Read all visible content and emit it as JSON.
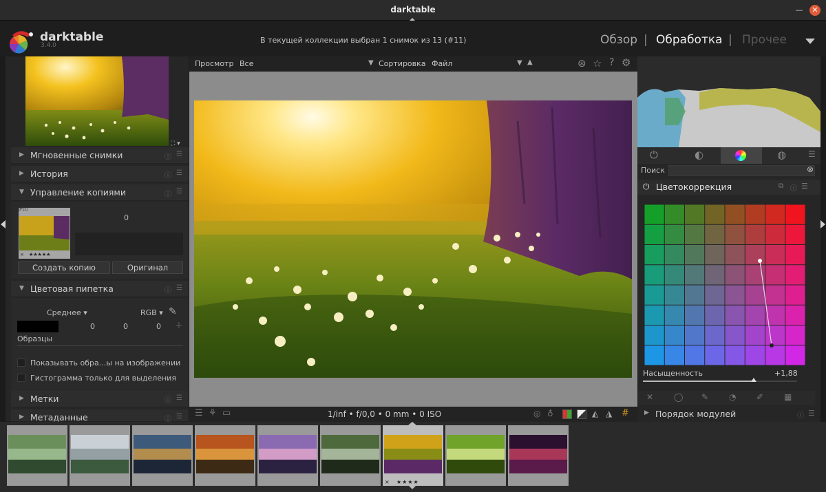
{
  "window": {
    "title": "darktable"
  },
  "header": {
    "app_name": "darktable",
    "version": "3.4.0",
    "collection_info": "В текущей коллекции выбран 1 снимок из 13 (#11)",
    "views": {
      "overview": "Обзор",
      "process": "Обработка",
      "other": "Прочее",
      "separator": "|"
    }
  },
  "left_panel": {
    "modules": {
      "snapshots": "Мгновенные снимки",
      "history": "История",
      "duplicates": "Управление копиями",
      "color_picker": "Цветовая пипетка",
      "tags": "Метки",
      "metadata": "Метаданные"
    },
    "duplicate_manager": {
      "thumb_badge": "JPEG",
      "count": "0",
      "stars": "★★★★★",
      "reject": "×",
      "create_copy": "Создать копию",
      "original": "Оригинал"
    },
    "color_picker": {
      "mode": "Среднее",
      "colorspace": "RGB",
      "values": [
        "0",
        "0",
        "0"
      ],
      "add": "+",
      "samples_label": "Образцы",
      "show_samples": "Показывать обра...ы на изображении",
      "histogram_only": "Гистограмма только для выделения"
    }
  },
  "center": {
    "toolbar": {
      "view_label": "Просмотр",
      "view_value": "Все",
      "sort_label": "Сортировка",
      "sort_value": "Файл"
    },
    "status": "1/inf • f/0,0 • 0 mm • 0 ISO"
  },
  "right_panel": {
    "search_label": "Поиск",
    "module_title": "Цветокоррекция",
    "saturation_label": "Насыщенность",
    "saturation_value": "+1,88",
    "saturation_fraction": 0.72,
    "module_order": "Порядок модулей"
  },
  "filmstrip": {
    "count": 9,
    "selected_index": 6,
    "selected_stars": "★★★★",
    "reject": "×"
  },
  "colors": {
    "accent": "#e05b3a",
    "panel": "#262626",
    "center_bg": "#8c8c8c"
  }
}
